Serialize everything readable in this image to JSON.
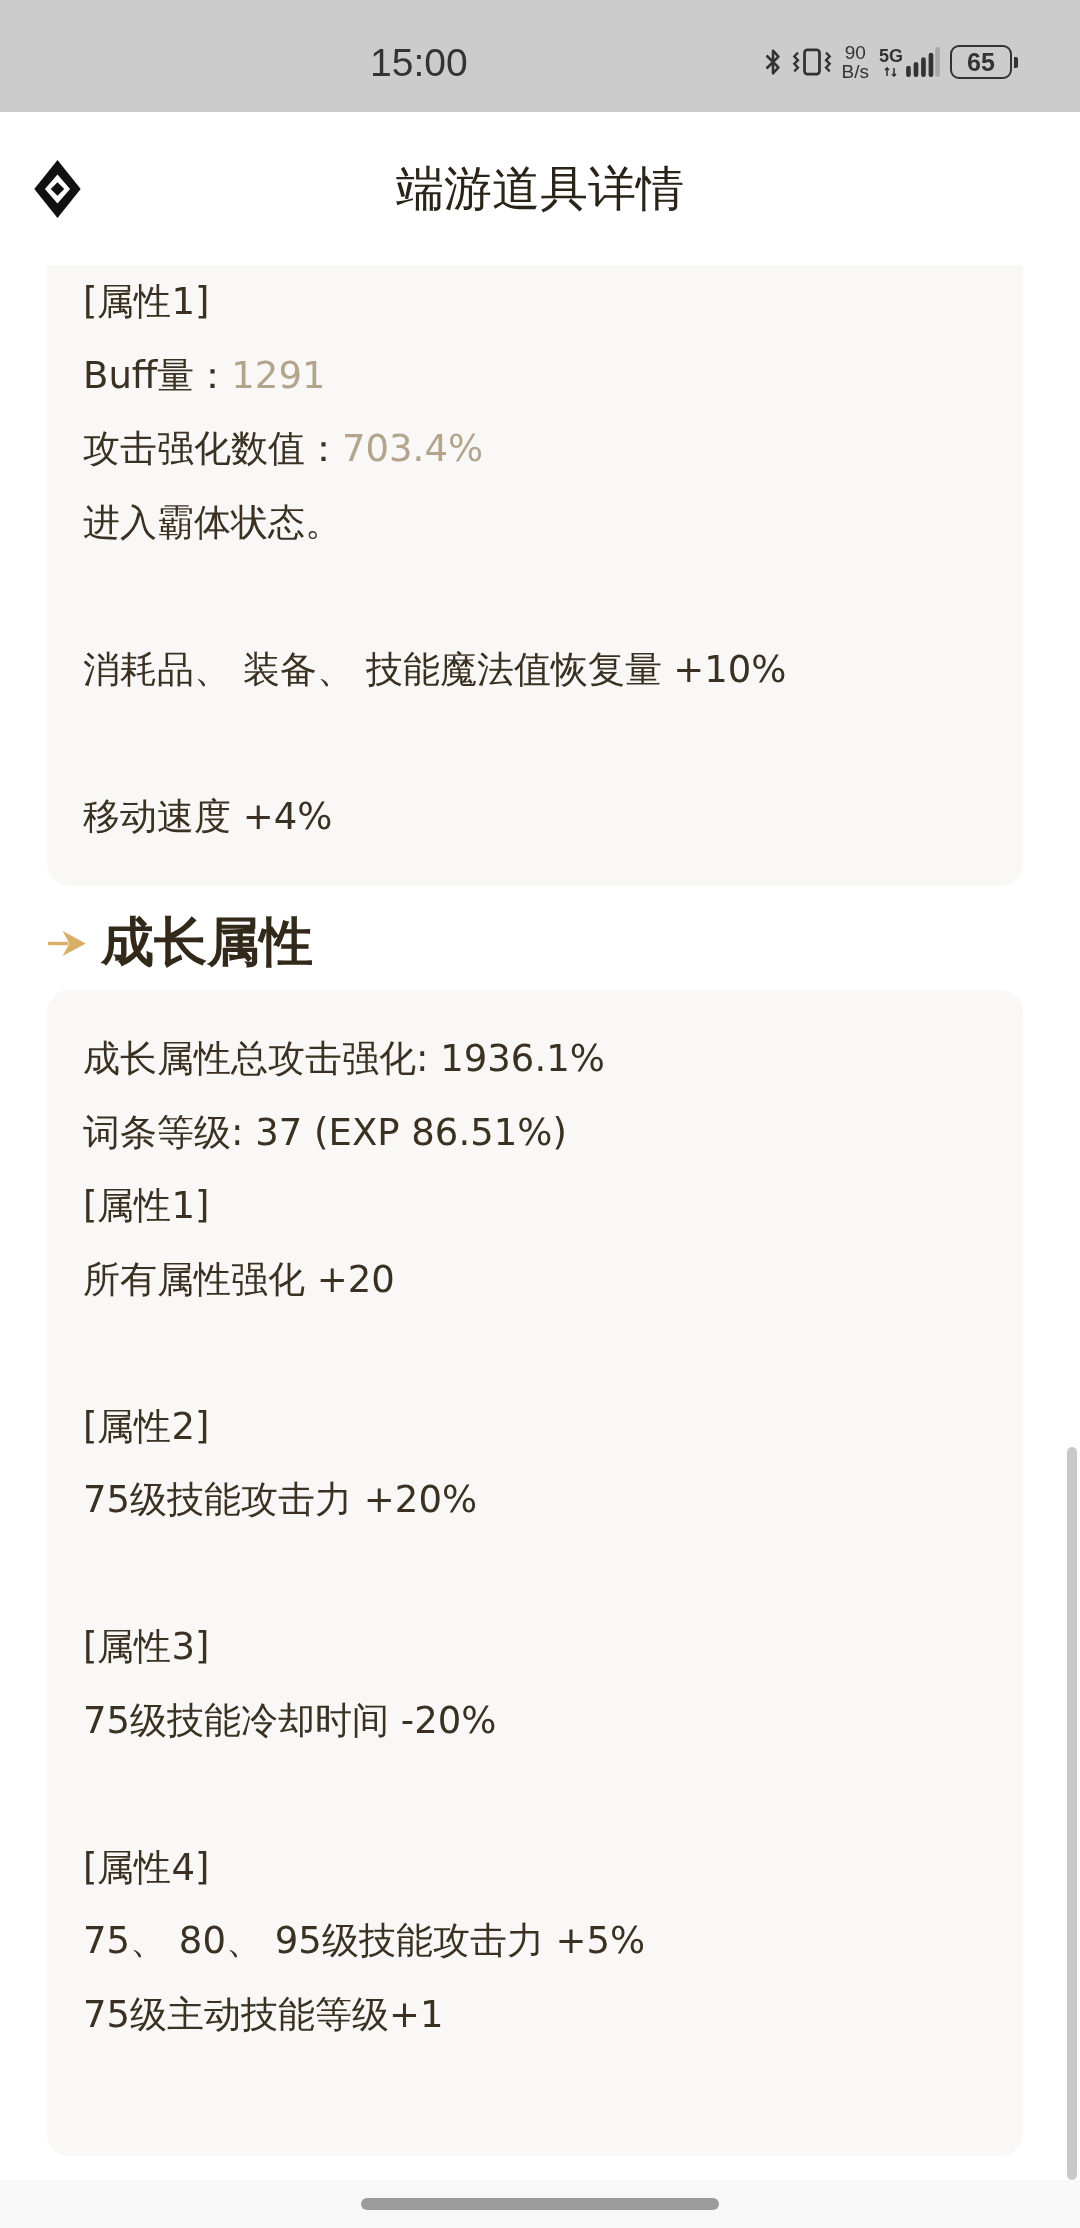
{
  "status_bar": {
    "time": "15:00",
    "net_speed": "90",
    "net_speed_unit": "B/s",
    "network": "5G",
    "battery": "65"
  },
  "header": {
    "title": "端游道具详情"
  },
  "effect_card": {
    "blocks": [
      {
        "lines": [
          {
            "kind": "text",
            "text": "[属性1]"
          },
          {
            "kind": "stat",
            "label": "Buff量：",
            "value": "1291"
          },
          {
            "kind": "stat",
            "label": "攻击强化数值：",
            "value": "703.4%"
          },
          {
            "kind": "text",
            "text": "进入霸体状态。"
          }
        ]
      },
      {
        "lines": [
          {
            "kind": "text",
            "text": "消耗品、 装备、 技能魔法值恢复量 +10%"
          }
        ]
      },
      {
        "lines": [
          {
            "kind": "text",
            "text": "移动速度 +4%"
          }
        ]
      }
    ]
  },
  "growth_section": {
    "title": "成长属性",
    "blocks": [
      {
        "lines": [
          {
            "kind": "text",
            "text": "成长属性总攻击强化: 1936.1%"
          },
          {
            "kind": "text",
            "text": "词条等级: 37 (EXP 86.51%)"
          },
          {
            "kind": "text",
            "text": "[属性1]"
          },
          {
            "kind": "text",
            "text": "所有属性强化 +20"
          }
        ]
      },
      {
        "lines": [
          {
            "kind": "text",
            "text": "[属性2]"
          },
          {
            "kind": "text",
            "text": "75级技能攻击力 +20%"
          }
        ]
      },
      {
        "lines": [
          {
            "kind": "text",
            "text": "[属性3]"
          },
          {
            "kind": "text",
            "text": "75级技能冷却时间 -20%"
          }
        ]
      },
      {
        "lines": [
          {
            "kind": "text",
            "text": "[属性4]"
          },
          {
            "kind": "text",
            "text": "75、 80、 95级技能攻击力 +5%"
          },
          {
            "kind": "text",
            "text": "75级主动技能等级+1"
          }
        ]
      }
    ]
  }
}
